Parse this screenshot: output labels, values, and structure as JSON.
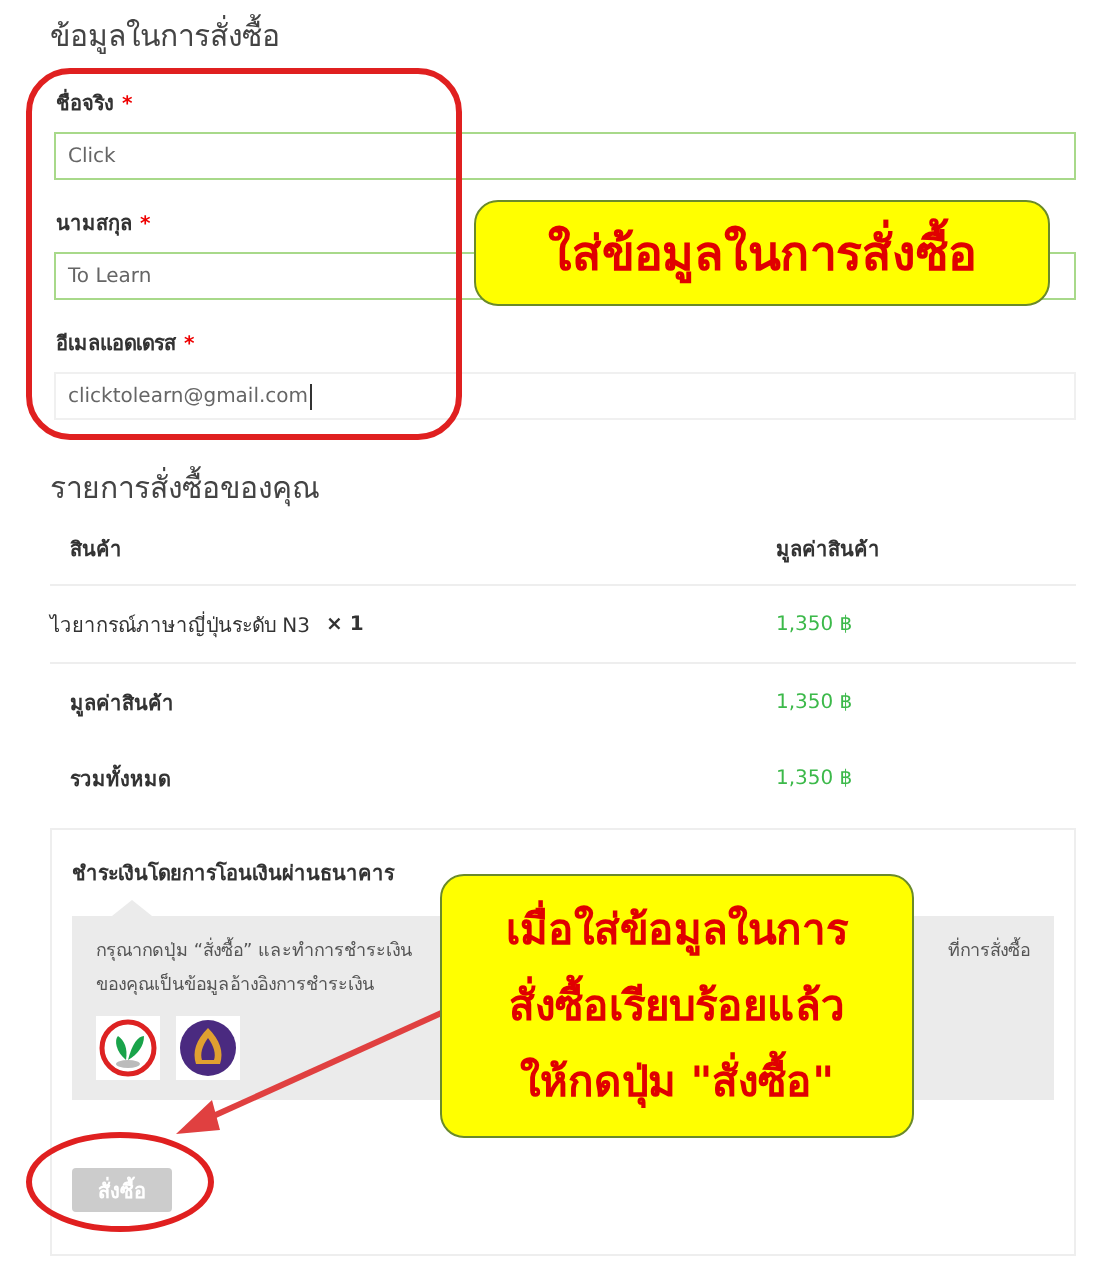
{
  "order_info": {
    "title": "ข้อมูลในการสั่งซื้อ",
    "fields": [
      {
        "label": "ชื่อจริง",
        "required_mark": "*",
        "value": "Click",
        "valid": true
      },
      {
        "label": "นามสกุล",
        "required_mark": "*",
        "value": "To Learn",
        "valid": true
      },
      {
        "label": "อีเมลแอดเดรส",
        "required_mark": "*",
        "value": "clicktolearn@gmail.com",
        "valid": false
      }
    ]
  },
  "order_summary": {
    "title": "รายการสั่งซื้อของคุณ",
    "columns": [
      "สินค้า",
      "มูลค่าสินค้า"
    ],
    "items": [
      {
        "name": "ไวยากรณ์ภาษาญี่ปุ่นระดับ N3",
        "quantity": "× 1",
        "price": "1,350 ฿"
      }
    ],
    "totals": [
      {
        "label": "มูลค่าสินค้า",
        "value": "1,350 ฿"
      },
      {
        "label": "รวมทั้งหมด",
        "value": "1,350 ฿"
      }
    ]
  },
  "payment": {
    "title": "ชำระเงินโดยการโอนเงินผ่านธนาคาร",
    "note_parts": [
      "กรุณากดปุ่ม “สั่งซื้อ” และทำการชำระเงิน",
      "ที่การสั่งซื้อ",
      "ของคุณเป็นข้อมูลอ้างอิงการชำระเงิน"
    ],
    "banks": [
      {
        "kind": "leaf"
      },
      {
        "kind": "temple"
      }
    ]
  },
  "submit_button": {
    "label": "สั่งซื้อ",
    "disabled": true
  },
  "annotations": [
    {
      "kind": "callout",
      "lines": [
        "ใส่ข้อมูลในการสั่งซื้อ"
      ]
    },
    {
      "kind": "callout",
      "lines": [
        "เมื่อใส่ข้อมูลในการ",
        "สั่งซื้อเรียบร้อยแล้ว",
        "ให้กดปุ่ม \"สั่งซื้อ\""
      ]
    }
  ]
}
